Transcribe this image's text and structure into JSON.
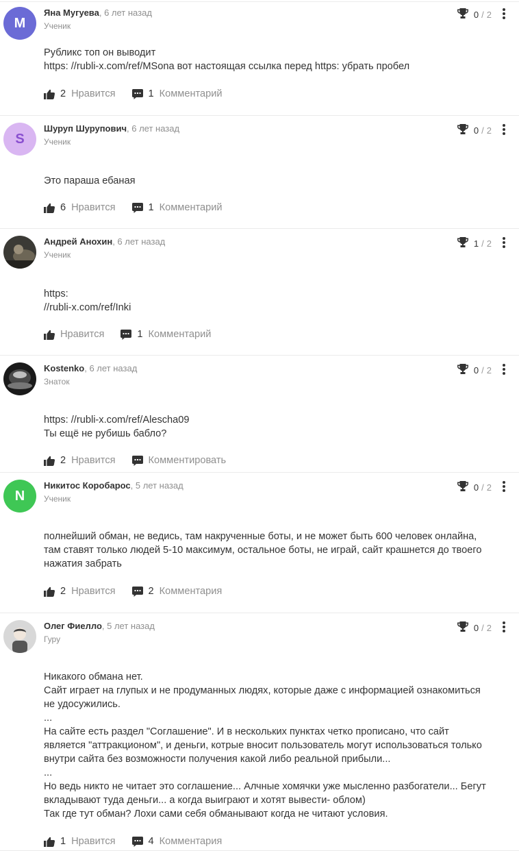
{
  "answers": [
    {
      "author": "Яна Мугуева",
      "time": ", 6 лет назад",
      "rank": "Ученик",
      "avatar": {
        "type": "letter",
        "letter": "M",
        "color": "#6b6bd6"
      },
      "score": {
        "current": "0",
        "max": "2"
      },
      "lines": [
        "Рубликс топ он выводит",
        "https: //rubli-x.com/ref/MSona вот настоящая ссылка перед https: убрать пробел"
      ],
      "likes": "2",
      "like_label": "Нравится",
      "comments": "1",
      "comment_label": "Комментарий"
    },
    {
      "author": "Шуруп Шурупович",
      "time": ", 6 лет назад",
      "rank": "Ученик",
      "avatar": {
        "type": "letter",
        "letter": "S",
        "color": "#d9b6f2",
        "text_color": "#8a4fd0"
      },
      "score": {
        "current": "0",
        "max": "2"
      },
      "lines": [
        "Это параша ебаная"
      ],
      "likes": "6",
      "like_label": "Нравится",
      "comments": "1",
      "comment_label": "Комментарий"
    },
    {
      "author": "Андрей Анохин",
      "time": ", 6 лет назад",
      "rank": "Ученик",
      "avatar": {
        "type": "photo",
        "bg": "#3b3a35",
        "fg": "#9a8f7a"
      },
      "score": {
        "current": "1",
        "max": "2"
      },
      "lines": [
        "https:",
        "//rubli-x.com/ref/Inki"
      ],
      "likes": "",
      "like_label": "Нравится",
      "comments": "1",
      "comment_label": "Комментарий"
    },
    {
      "author": "Kostenko",
      "time": ", 6 лет назад",
      "rank": "Знаток",
      "avatar": {
        "type": "photo",
        "bg": "#1a1a1a",
        "fg": "#bfbfbf"
      },
      "score": {
        "current": "0",
        "max": "2"
      },
      "lines": [
        "https: //rubli-x.com/ref/Alescha09",
        "Ты ещё не рубишь бабло?"
      ],
      "likes": "2",
      "like_label": "Нравится",
      "comments": "",
      "comment_label": "Комментировать"
    },
    {
      "author": "Никитос Коробарос",
      "time": ", 5 лет назад",
      "rank": "Ученик",
      "avatar": {
        "type": "letter",
        "letter": "N",
        "color": "#3fc755"
      },
      "score": {
        "current": "0",
        "max": "2"
      },
      "lines": [
        "полнейший обман, не ведись, там накрученные боты, и не может быть 600 человек онлайна,",
        "там ставят только людей 5-10 максимум, остальное боты, не играй, сайт крашнется до твоего",
        "нажатия забрать"
      ],
      "likes": "2",
      "like_label": "Нравится",
      "comments": "2",
      "comment_label": "Комментария"
    },
    {
      "author": "Олег Фиелло",
      "time": ", 5 лет назад",
      "rank": "Гуру",
      "avatar": {
        "type": "photo",
        "bg": "#d8d8d8",
        "fg": "#555555"
      },
      "score": {
        "current": "0",
        "max": "2"
      },
      "lines": [
        "Никакого обмана нет.",
        "Сайт играет на глупых и не продуманных людях, которые даже с информацией ознакомиться",
        "не удосужились.",
        "...",
        "На сайте есть раздел \"Соглашение\". И в нескольких пунктах четко прописано, что сайт",
        "является \"аттракционом\", и деньги, котрые вносит пользователь могут использоваться только",
        "внутри сайта без возможности получения какой либо реальной прибыли...",
        "...",
        "Но ведь никто не читает это соглашение... Алчные хомячки уже мысленно разбогатели... Бегут",
        "вкладывают туда деньги... а когда выиграют и хотят вывести- облом)",
        "Так где тут обман? Лохи сами себя обманывают когда не читают условия."
      ],
      "likes": "1",
      "like_label": "Нравится",
      "comments": "4",
      "comment_label": "Комментария"
    }
  ]
}
